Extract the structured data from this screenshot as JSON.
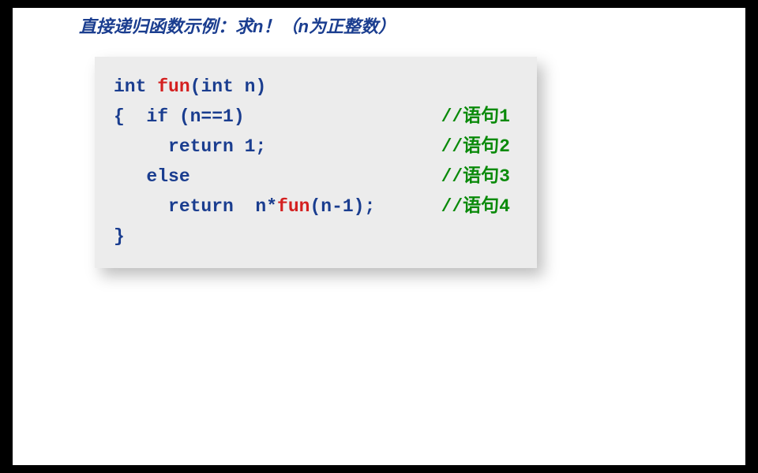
{
  "title": {
    "prefix": "直接递归函数示例：求",
    "var1": "n",
    "exclaim": "！（",
    "var2": "n",
    "suffix": "为正整数）"
  },
  "code": {
    "l1_kw1": "int ",
    "l1_fn": "fun",
    "l1_rest": "(int n)",
    "l2_code": "{  if (n==1)",
    "l2_cm": "//语句1",
    "l3_code": "     return 1;",
    "l3_cm": "//语句2",
    "l4_code": "   else",
    "l4_cm": "//语句3",
    "l5_code1": "     return  n*",
    "l5_fn": "fun",
    "l5_code2": "(n-1);",
    "l5_cm": "//语句4",
    "l6_code": "}"
  }
}
